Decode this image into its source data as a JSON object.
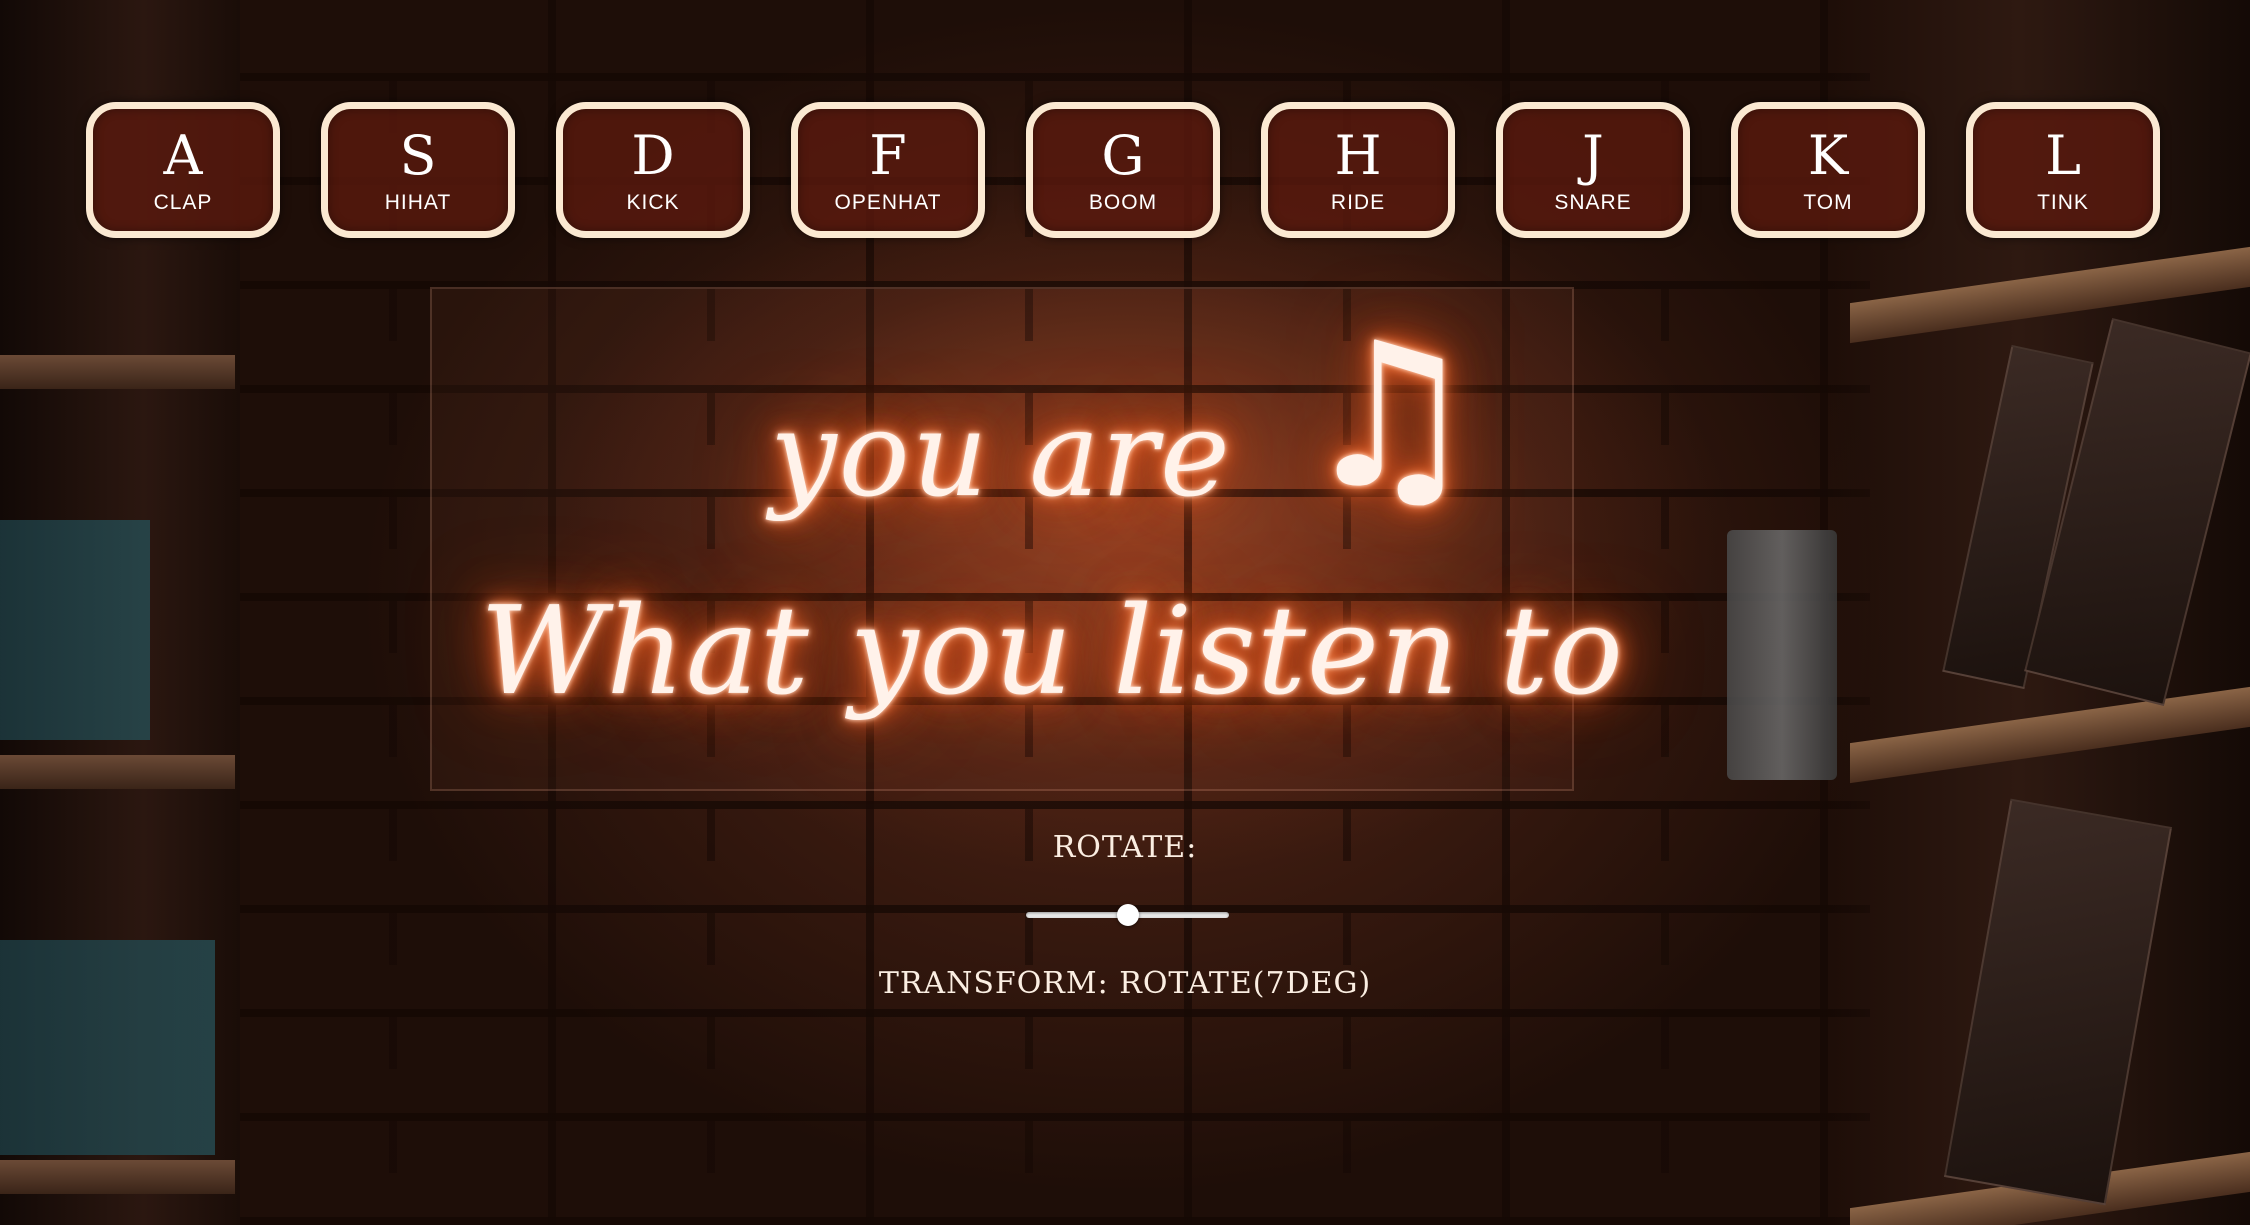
{
  "keys": [
    {
      "letter": "A",
      "sound": "CLAP"
    },
    {
      "letter": "S",
      "sound": "HIHAT"
    },
    {
      "letter": "D",
      "sound": "KICK"
    },
    {
      "letter": "F",
      "sound": "OPENHAT"
    },
    {
      "letter": "G",
      "sound": "BOOM"
    },
    {
      "letter": "H",
      "sound": "RIDE"
    },
    {
      "letter": "J",
      "sound": "SNARE"
    },
    {
      "letter": "K",
      "sound": "TOM"
    },
    {
      "letter": "L",
      "sound": "TINK"
    }
  ],
  "neon_sign": {
    "line1": "you are",
    "note": "♫",
    "line2": "What you listen to"
  },
  "rotate": {
    "label": "ROTATE:",
    "slider_fraction": 0.5,
    "readout": "TRANSFORM: ROTATE(7DEG)"
  },
  "colors": {
    "key_border": "#fbe9d2",
    "key_fill": "#5c1a0e",
    "neon_glow": "#ff6a2a",
    "text": "#fbeee2"
  },
  "icons": {
    "slider_thumb": "circle-knob"
  }
}
